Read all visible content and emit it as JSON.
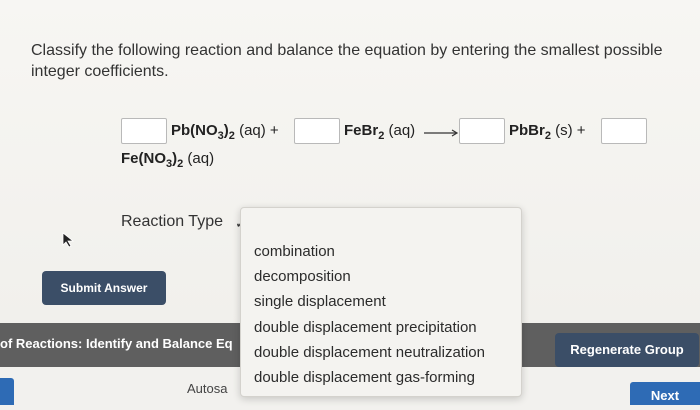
{
  "question": {
    "text": "Classify the following reaction and balance the equation by entering the smallest possible integer coefficients."
  },
  "equation": {
    "reactant1": "Pb(NO3)2",
    "reactant1_state": "(aq) +",
    "reactant2": "FeBr2",
    "reactant2_state": "(aq)",
    "product1": "PbBr2",
    "product1_state": "(s) +",
    "product2": "Fe(NO3)2",
    "product2_state": "(aq)"
  },
  "reaction_type": {
    "label": "Reaction Type",
    "check_glyph": "✓",
    "options": [
      "combination",
      "decomposition",
      "single displacement",
      "double displacement precipitation",
      "double displacement neutralization",
      "double displacement gas-forming"
    ]
  },
  "buttons": {
    "submit": "Submit Answer",
    "regenerate": "Regenerate Group",
    "next": "Next"
  },
  "footer": {
    "title": "of Reactions: Identify and Balance Eq",
    "autosave": "Autosa"
  },
  "icons": [
    "cursor-icon",
    "check-icon",
    "arrow-icon"
  ],
  "colors": {
    "primary_button": "#3b4e67",
    "footer_bar": "#5f5f5f",
    "next_button": "#2e6bb5"
  }
}
